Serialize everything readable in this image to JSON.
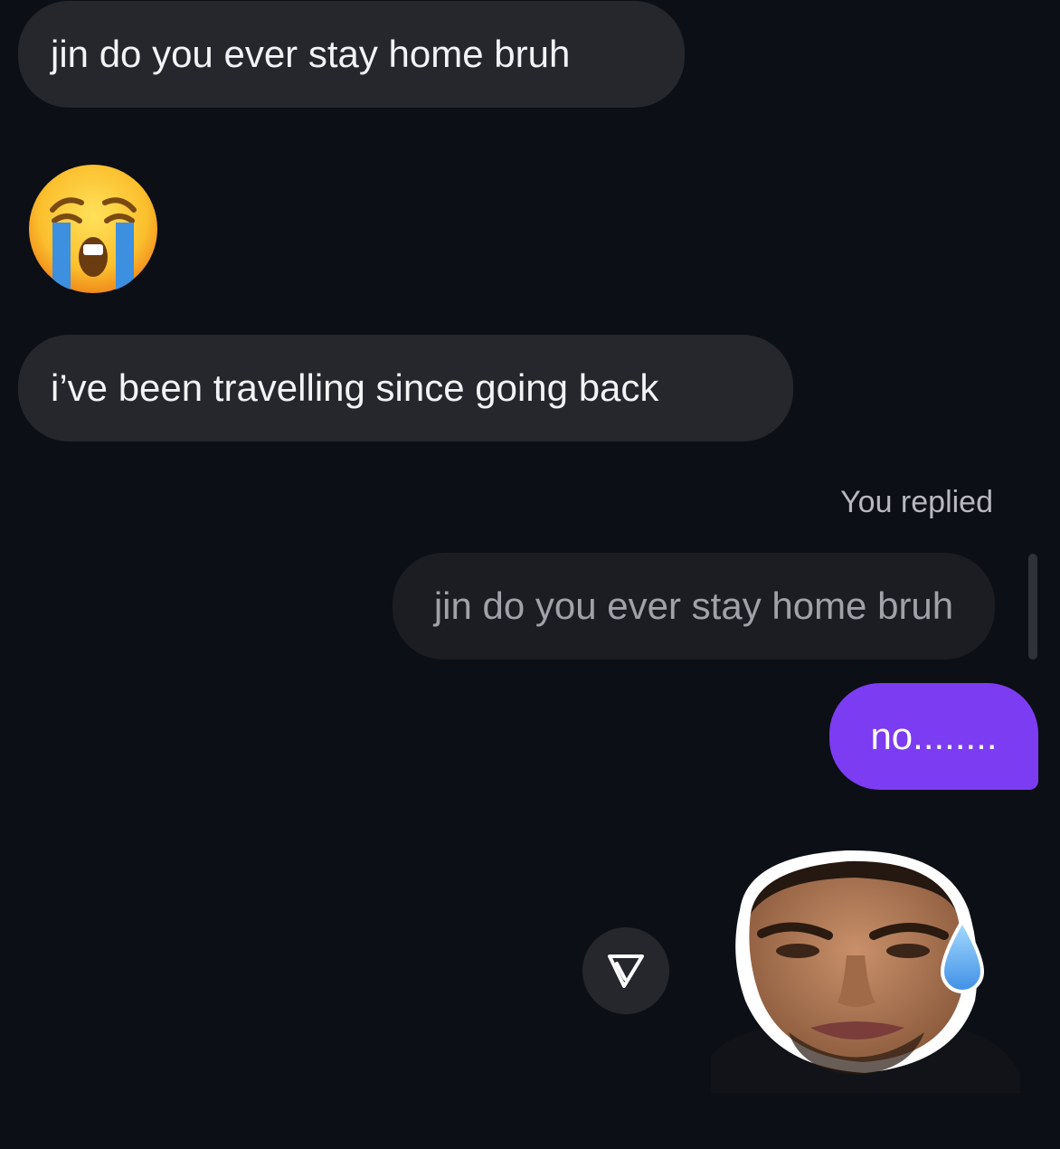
{
  "messages": {
    "incoming_1": "jin do you ever stay home bruh",
    "incoming_2_emoji": "loudly-crying-face-emoji",
    "incoming_3": "i’ve been travelling since going back"
  },
  "reply_context": {
    "label": "You replied",
    "quoted_text": "jin do you ever stay home bruh"
  },
  "outgoing": {
    "text": "no........"
  },
  "actions": {
    "share_icon": "send-icon"
  },
  "sticker": {
    "icon": "sweating-man-face-sticker"
  },
  "colors": {
    "background": "#0c0f16",
    "incoming_bubble": "#25272d",
    "quoted_bubble": "#1b1d22",
    "outgoing_bubble": "#7c3cf2"
  }
}
